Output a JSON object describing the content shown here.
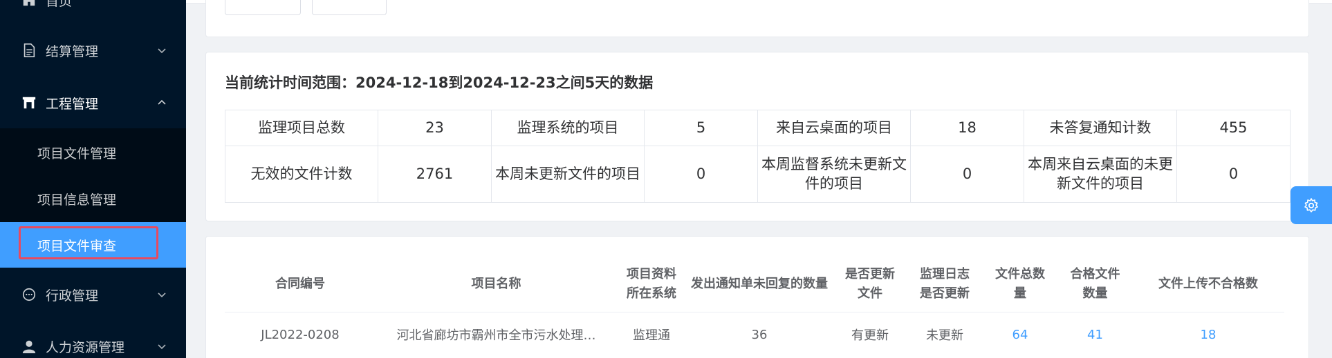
{
  "sidebar": {
    "items": [
      {
        "label": "首页",
        "icon": "home-icon"
      },
      {
        "label": "结算管理",
        "icon": "document-icon"
      },
      {
        "label": "工程管理",
        "icon": "building-icon"
      },
      {
        "label": "行政管理",
        "icon": "chat-icon"
      },
      {
        "label": "人力资源管理",
        "icon": "user-icon"
      }
    ],
    "subitems": [
      {
        "label": "项目文件管理"
      },
      {
        "label": "项目信息管理"
      },
      {
        "label": "项目文件审查",
        "active": true
      }
    ]
  },
  "stats": {
    "title": "当前统计时间范围：2024-12-18到2024-12-23之间5天的数据",
    "row1": [
      {
        "label": "监理项目总数",
        "value": "23"
      },
      {
        "label": "监理系统的项目",
        "value": "5"
      },
      {
        "label": "来自云桌面的项目",
        "value": "18"
      },
      {
        "label": "未答复通知计数",
        "value": "455"
      }
    ],
    "row2": [
      {
        "label": "无效的文件计数",
        "value": "2761"
      },
      {
        "label": "本周未更新文件的项目",
        "value": "0"
      },
      {
        "label": "本周监督系统未更新文件的项目",
        "value": "0"
      },
      {
        "label": "本周来自云桌面的未更新文件的项目",
        "value": "0"
      }
    ]
  },
  "table": {
    "headers": [
      "合同编号",
      "项目名称",
      "项目资料\n所在系统",
      "发出通知单未回复的数量",
      "是否更新\n文件",
      "监理日志\n是否更新",
      "文件总数\n量",
      "合格文件\n数量",
      "文件上传不合格数"
    ],
    "rows": [
      [
        "JL2022-0208",
        "河北省廊坊市霸州市全市污水处理…",
        "监理通",
        "36",
        "有更新",
        "未更新",
        "64",
        "41",
        "18"
      ]
    ]
  },
  "accent_color": "#409eff",
  "sidebar_color": "#001529"
}
